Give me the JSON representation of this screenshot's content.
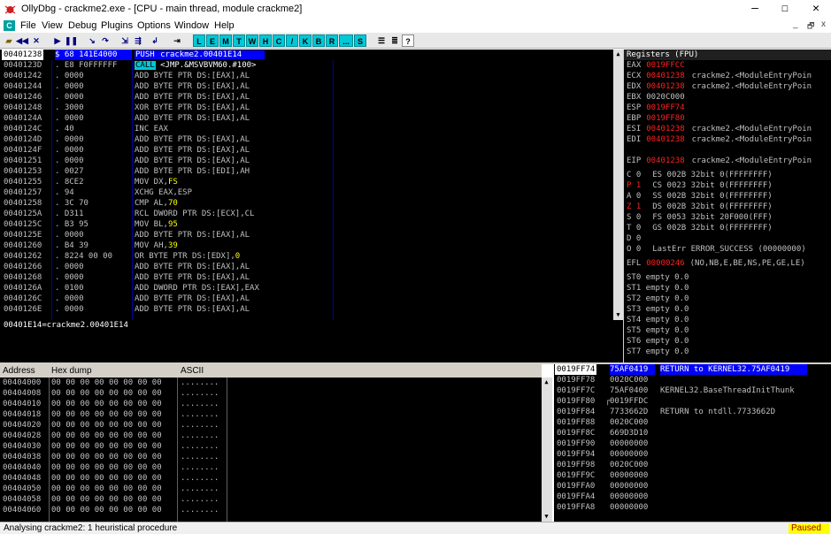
{
  "window": {
    "title": "OllyDbg - crackme2.exe - [CPU - main thread, module crackme2]",
    "minimize": "—",
    "maximize": "☐",
    "close": "✕"
  },
  "menu": {
    "items": [
      "File",
      "View",
      "Debug",
      "Plugins",
      "Options",
      "Window",
      "Help"
    ],
    "mdi_min": "_",
    "mdi_restore": "🗗",
    "mdi_close": "x"
  },
  "toolbar": {
    "letters": [
      "L",
      "E",
      "M",
      "T",
      "W",
      "H",
      "C",
      "/",
      "K",
      "B",
      "R",
      "...",
      "S"
    ]
  },
  "cpu": {
    "rows": [
      {
        "addr": "00401238",
        "hex": "$ 68 141E4000",
        "asm": "PUSH crackme2.00401E14",
        "sel": true
      },
      {
        "addr": "0040123D",
        "hex": ". E8 F0FFFFFF",
        "asm": "CALL <JMP.&MSVBVM60.#100>",
        "call": true
      },
      {
        "addr": "00401242",
        "hex": ". 0000",
        "asm": "ADD BYTE PTR DS:[EAX],AL"
      },
      {
        "addr": "00401244",
        "hex": ". 0000",
        "asm": "ADD BYTE PTR DS:[EAX],AL"
      },
      {
        "addr": "00401246",
        "hex": ". 0000",
        "asm": "ADD BYTE PTR DS:[EAX],AL"
      },
      {
        "addr": "00401248",
        "hex": ". 3000",
        "asm": "XOR BYTE PTR DS:[EAX],AL"
      },
      {
        "addr": "0040124A",
        "hex": ". 0000",
        "asm": "ADD BYTE PTR DS:[EAX],AL"
      },
      {
        "addr": "0040124C",
        "hex": ". 40",
        "asm": "INC EAX"
      },
      {
        "addr": "0040124D",
        "hex": ". 0000",
        "asm": "ADD BYTE PTR DS:[EAX],AL"
      },
      {
        "addr": "0040124F",
        "hex": ". 0000",
        "asm": "ADD BYTE PTR DS:[EAX],AL"
      },
      {
        "addr": "00401251",
        "hex": ". 0000",
        "asm": "ADD BYTE PTR DS:[EAX],AL"
      },
      {
        "addr": "00401253",
        "hex": ". 0027",
        "asm": "ADD BYTE PTR DS:[EDI],AH"
      },
      {
        "addr": "00401255",
        "hex": ". 8CE2",
        "asm": "MOV DX,",
        "imm": "FS"
      },
      {
        "addr": "00401257",
        "hex": ". 94",
        "asm": "XCHG EAX,ESP"
      },
      {
        "addr": "00401258",
        "hex": ". 3C 70",
        "asm": "CMP AL,",
        "imm": "70"
      },
      {
        "addr": "0040125A",
        "hex": ". D311",
        "asm": "RCL DWORD PTR DS:[ECX],CL"
      },
      {
        "addr": "0040125C",
        "hex": ". B3 95",
        "asm": "MOV BL,",
        "imm": "95"
      },
      {
        "addr": "0040125E",
        "hex": ". 0000",
        "asm": "ADD BYTE PTR DS:[EAX],AL"
      },
      {
        "addr": "00401260",
        "hex": ". B4 39",
        "asm": "MOV AH,",
        "imm": "39"
      },
      {
        "addr": "00401262",
        "hex": ". 8224 00 00",
        "asm": "OR BYTE PTR DS:[EDX],",
        "imm": "0"
      },
      {
        "addr": "00401266",
        "hex": ". 0000",
        "asm": "ADD BYTE PTR DS:[EAX],AL"
      },
      {
        "addr": "00401268",
        "hex": ". 0000",
        "asm": "ADD BYTE PTR DS:[EAX],AL"
      },
      {
        "addr": "0040126A",
        "hex": ". 0100",
        "asm": "ADD DWORD PTR DS:[EAX],EAX"
      },
      {
        "addr": "0040126C",
        "hex": ". 0000",
        "asm": "ADD BYTE PTR DS:[EAX],AL"
      },
      {
        "addr": "0040126E",
        "hex": ". 0000",
        "asm": "ADD BYTE PTR DS:[EAX],AL"
      }
    ]
  },
  "info": {
    "text": "00401E14=crackme2.00401E14"
  },
  "registers": {
    "title": "Registers (FPU)",
    "gp": [
      {
        "name": "EAX",
        "value": "0019FFCC",
        "red": true,
        "comment": ""
      },
      {
        "name": "ECX",
        "value": "00401238",
        "red": true,
        "comment": "crackme2.<ModuleEntryPoin"
      },
      {
        "name": "EDX",
        "value": "00401238",
        "red": true,
        "comment": "crackme2.<ModuleEntryPoin"
      },
      {
        "name": "EBX",
        "value": "0020C000",
        "red": false,
        "comment": ""
      },
      {
        "name": "ESP",
        "value": "0019FF74",
        "red": true,
        "comment": ""
      },
      {
        "name": "EBP",
        "value": "0019FF80",
        "red": true,
        "comment": ""
      },
      {
        "name": "ESI",
        "value": "00401238",
        "red": true,
        "comment": "crackme2.<ModuleEntryPoin"
      },
      {
        "name": "EDI",
        "value": "00401238",
        "red": true,
        "comment": "crackme2.<ModuleEntryPoin"
      }
    ],
    "eip": {
      "name": "EIP",
      "value": "00401238",
      "comment": "crackme2.<ModuleEntryPoin"
    },
    "flags": [
      {
        "flag": "C 0",
        "seg": "ES 002B 32bit 0(FFFFFFFF)",
        "red": false
      },
      {
        "flag": "P 1",
        "seg": "CS 0023 32bit 0(FFFFFFFF)",
        "red": true
      },
      {
        "flag": "A 0",
        "seg": "SS 002B 32bit 0(FFFFFFFF)",
        "red": false
      },
      {
        "flag": "Z 1",
        "seg": "DS 002B 32bit 0(FFFFFFFF)",
        "red": true
      },
      {
        "flag": "S 0",
        "seg": "FS 0053 32bit 20F000(FFF)",
        "red": false
      },
      {
        "flag": "T 0",
        "seg": "GS 002B 32bit 0(FFFFFFFF)",
        "red": false
      },
      {
        "flag": "D 0",
        "seg": "",
        "red": false
      },
      {
        "flag": "O 0",
        "seg": "LastErr ERROR_SUCCESS (00000000)",
        "red": false
      }
    ],
    "efl": {
      "name": "EFL",
      "value": "00000246",
      "comment": "(NO,NB,E,BE,NS,PE,GE,LE)"
    },
    "st": [
      "ST0 empty 0.0",
      "ST1 empty 0.0",
      "ST2 empty 0.0",
      "ST3 empty 0.0",
      "ST4 empty 0.0",
      "ST5 empty 0.0",
      "ST6 empty 0.0",
      "ST7 empty 0.0"
    ]
  },
  "dump": {
    "headers": {
      "address": "Address",
      "hex": "Hex dump",
      "ascii": "ASCII"
    },
    "rows": [
      {
        "addr": "00404000",
        "hex": "00 00 00 00 00 00 00 00",
        "ascii": "........"
      },
      {
        "addr": "00404008",
        "hex": "00 00 00 00 00 00 00 00",
        "ascii": "........"
      },
      {
        "addr": "00404010",
        "hex": "00 00 00 00 00 00 00 00",
        "ascii": "........"
      },
      {
        "addr": "00404018",
        "hex": "00 00 00 00 00 00 00 00",
        "ascii": "........"
      },
      {
        "addr": "00404020",
        "hex": "00 00 00 00 00 00 00 00",
        "ascii": "........"
      },
      {
        "addr": "00404028",
        "hex": "00 00 00 00 00 00 00 00",
        "ascii": "........"
      },
      {
        "addr": "00404030",
        "hex": "00 00 00 00 00 00 00 00",
        "ascii": "........"
      },
      {
        "addr": "00404038",
        "hex": "00 00 00 00 00 00 00 00",
        "ascii": "........"
      },
      {
        "addr": "00404040",
        "hex": "00 00 00 00 00 00 00 00",
        "ascii": "........"
      },
      {
        "addr": "00404048",
        "hex": "00 00 00 00 00 00 00 00",
        "ascii": "........"
      },
      {
        "addr": "00404050",
        "hex": "00 00 00 00 00 00 00 00",
        "ascii": "........"
      },
      {
        "addr": "00404058",
        "hex": "00 00 00 00 00 00 00 00",
        "ascii": "........"
      },
      {
        "addr": "00404060",
        "hex": "00 00 00 00 00 00 00 00",
        "ascii": "........"
      }
    ]
  },
  "stack": {
    "rows": [
      {
        "addr": "0019FF74",
        "value": "75AF0419",
        "comment": "RETURN to KERNEL32.75AF0419",
        "sel": true
      },
      {
        "addr": "0019FF78",
        "value": "0020C000",
        "comment": ""
      },
      {
        "addr": "0019FF7C",
        "value": "75AF0400",
        "comment": "KERNEL32.BaseThreadInitThunk"
      },
      {
        "addr": "0019FF80",
        "value": "0019FFDC",
        "comment": "",
        "frame": true
      },
      {
        "addr": "0019FF84",
        "value": "7733662D",
        "comment": "RETURN to ntdll.7733662D"
      },
      {
        "addr": "0019FF88",
        "value": "0020C000",
        "comment": ""
      },
      {
        "addr": "0019FF8C",
        "value": "669D3D10",
        "comment": ""
      },
      {
        "addr": "0019FF90",
        "value": "00000000",
        "comment": ""
      },
      {
        "addr": "0019FF94",
        "value": "00000000",
        "comment": ""
      },
      {
        "addr": "0019FF98",
        "value": "0020C000",
        "comment": ""
      },
      {
        "addr": "0019FF9C",
        "value": "00000000",
        "comment": ""
      },
      {
        "addr": "0019FFA0",
        "value": "00000000",
        "comment": ""
      },
      {
        "addr": "0019FFA4",
        "value": "00000000",
        "comment": ""
      },
      {
        "addr": "0019FFA8",
        "value": "00000000",
        "comment": ""
      }
    ]
  },
  "status": {
    "text": "Analysing crackme2: 1 heuristical procedure",
    "state": "Paused"
  }
}
